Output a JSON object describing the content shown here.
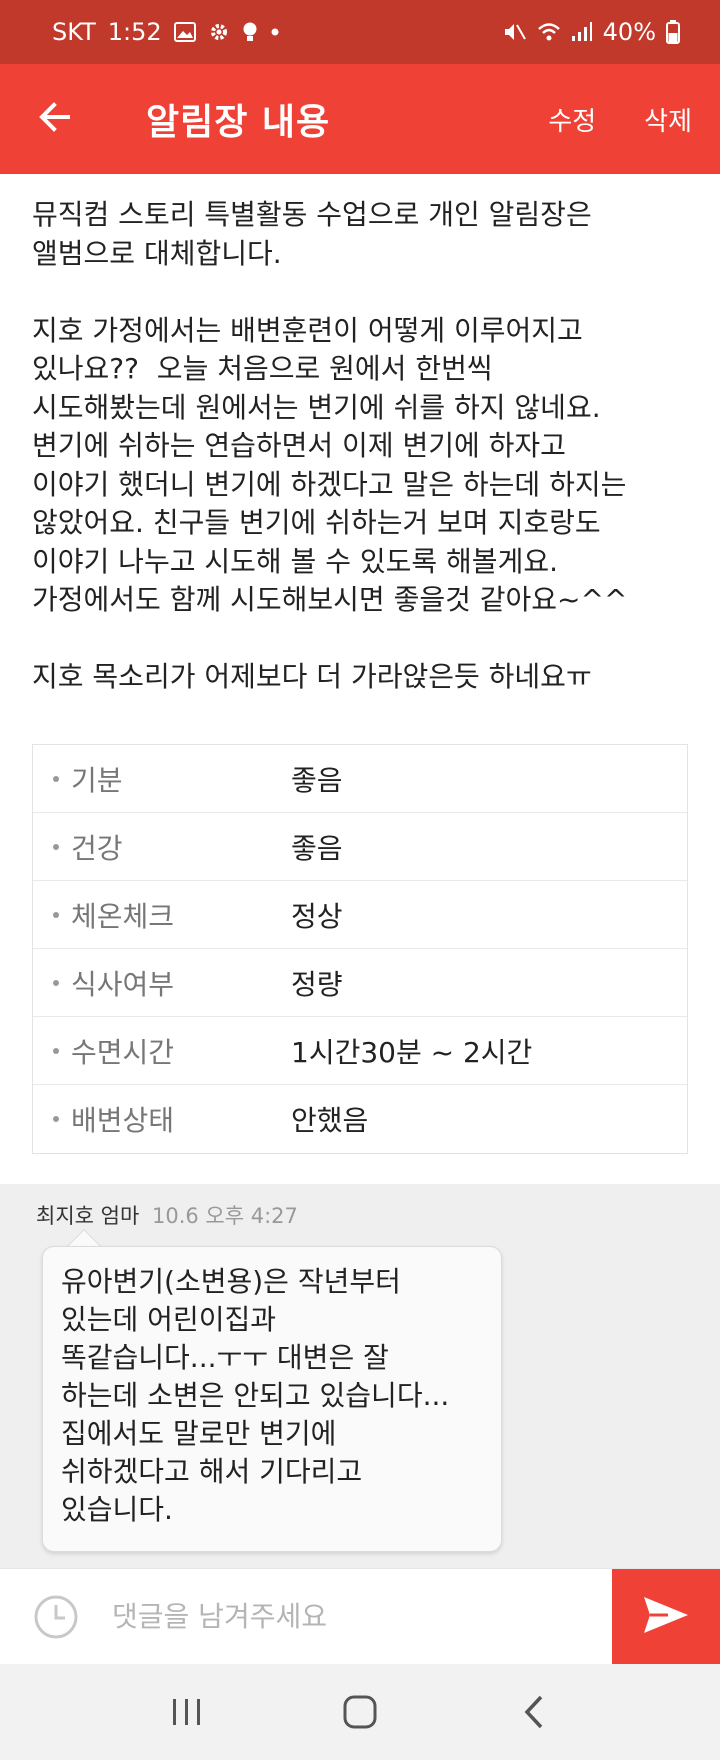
{
  "status_bar": {
    "carrier": "SKT",
    "time": "1:52",
    "battery": "40%",
    "icons": [
      "image-icon",
      "gear-icon",
      "bulb-icon",
      "dot-icon",
      "mute-icon",
      "wifi-icon",
      "signal-icon",
      "battery-icon"
    ]
  },
  "app_bar": {
    "title": "알림장 내용",
    "edit_label": "수정",
    "delete_label": "삭제",
    "back_icon": "arrow-left-icon"
  },
  "message": {
    "body": "뮤직컴 스토리 특별활동 수업으로 개인 알림장은\n앨범으로 대체합니다.\n\n지호 가정에서는 배변훈련이 어떻게 이루어지고\n있나요??  오늘 처음으로 원에서 한번씩\n시도해봤는데 원에서는 변기에 쉬를 하지 않네요.\n변기에 쉬하는 연습하면서 이제 변기에 하자고\n이야기 했더니 변기에 하겠다고 말은 하는데 하지는\n않았어요. 친구들 변기에 쉬하는거 보며 지호랑도\n이야기 나누고 시도해 볼 수 있도록 해볼게요.\n가정에서도 함께 시도해보시면 좋을것 같아요~^^\n\n지호 목소리가 어제보다 더 가라앉은듯 하네요ㅠ"
  },
  "info_table": {
    "rows": [
      {
        "label": "기분",
        "value": "좋음"
      },
      {
        "label": "건강",
        "value": "좋음"
      },
      {
        "label": "체온체크",
        "value": "정상"
      },
      {
        "label": "식사여부",
        "value": "정량"
      },
      {
        "label": "수면시간",
        "value": "1시간30분 ~ 2시간"
      },
      {
        "label": "배변상태",
        "value": "안했음"
      }
    ]
  },
  "comments": [
    {
      "author": "최지호 엄마",
      "time": "10.6 오후 4:27",
      "text": "유아변기(소변용)은 작년부터\n있는데 어린이집과\n똑같습니다...ㅜㅜ 대변은 잘\n하는데 소변은 안되고 있습니다...\n집에서도 말로만 변기에\n쉬하겠다고 해서 기다리고\n있습니다."
    }
  ],
  "comment_input": {
    "placeholder": "댓글을 남겨주세요",
    "value": ""
  },
  "colors": {
    "status_bar": "#c0392b",
    "accent": "#f04136"
  }
}
